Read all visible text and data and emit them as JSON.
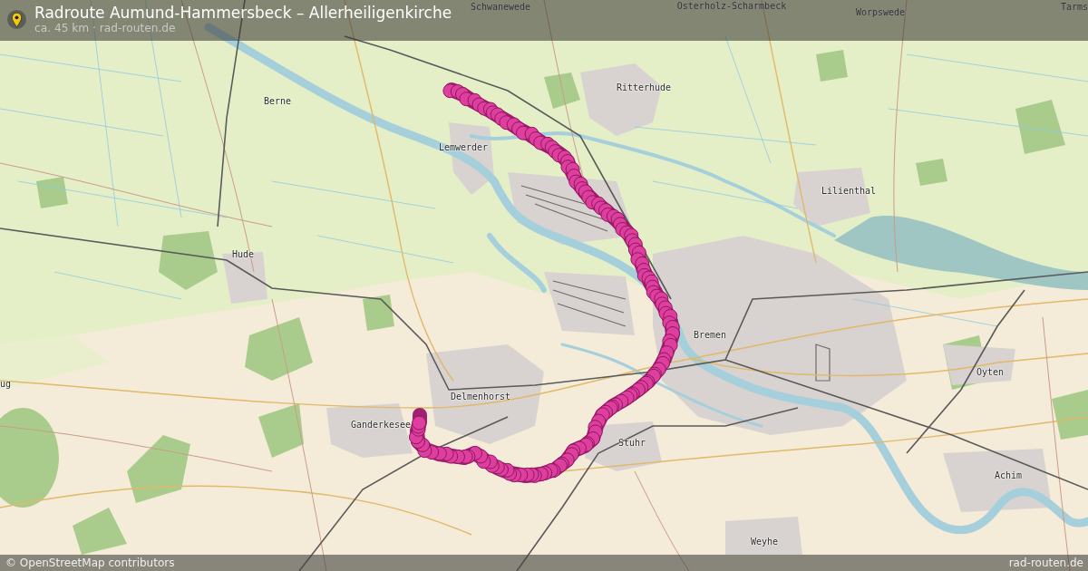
{
  "header": {
    "title": "Radroute Aumund-Hammersbeck – Allerheiligenkirche",
    "subtitle": "ca. 45 km · rad-routen.de"
  },
  "map": {
    "place_labels": [
      "Schwanewede",
      "Osterholz-Scharmbeck",
      "Worpswede",
      "Tarms",
      "Ritterhude",
      "Berne",
      "Lemwerder",
      "Lilienthal",
      "Hude",
      "Bremen",
      "Oyten",
      "ug",
      "Delmenhorst",
      "Ganderkesee",
      "Stuhr",
      "Achim",
      "Weyhe"
    ]
  },
  "footer": {
    "attribution": "© OpenStreetMap contributors",
    "site": "rad-routen.de"
  }
}
